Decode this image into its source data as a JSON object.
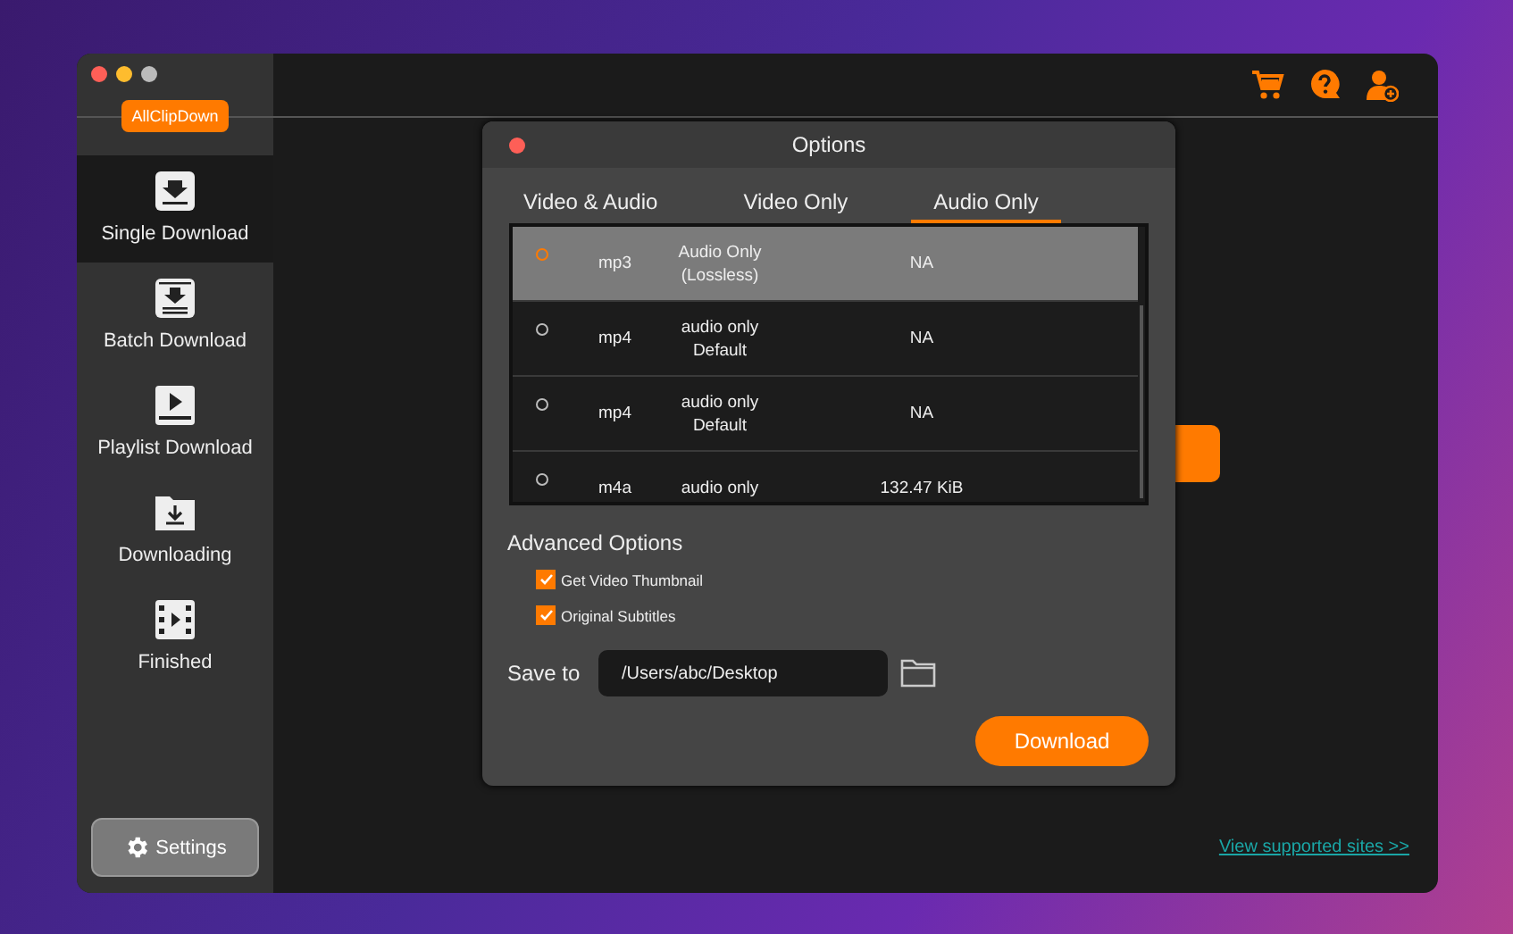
{
  "window": {
    "app_name": "AllClipDown"
  },
  "sidebar": {
    "items": [
      {
        "label": "Single Download",
        "selected": true
      },
      {
        "label": "Batch Download",
        "selected": false
      },
      {
        "label": "Playlist Download",
        "selected": false
      },
      {
        "label": "Downloading",
        "selected": false
      },
      {
        "label": "Finished",
        "selected": false
      }
    ],
    "settings_button": "Settings"
  },
  "dialog": {
    "title": "Options",
    "tabs": [
      {
        "label": "Video & Audio",
        "selected": false
      },
      {
        "label": "Video Only",
        "selected": false
      },
      {
        "label": "Audio Only",
        "selected": true
      }
    ],
    "formats": [
      {
        "format": "mp3",
        "quality": "Audio Only\n(Lossless)",
        "size": "NA",
        "selected": true
      },
      {
        "format": "mp4",
        "quality": "audio only\nDefault",
        "size": "NA",
        "selected": false
      },
      {
        "format": "mp4",
        "quality": "audio only\nDefault",
        "size": "NA",
        "selected": false
      },
      {
        "format": "m4a",
        "quality": "audio only",
        "size": "132.47 KiB",
        "selected": false
      }
    ],
    "advanced_options": {
      "title": "Advanced Options",
      "options": [
        {
          "label": "Get Video Thumbnail",
          "checked": true
        },
        {
          "label": "Original Subtitles",
          "checked": true
        }
      ]
    },
    "save_to": {
      "label": "Save to",
      "value": "/Users/abc/Desktop"
    },
    "download_button": "Download"
  },
  "footer_link": "View supported sites >>"
}
